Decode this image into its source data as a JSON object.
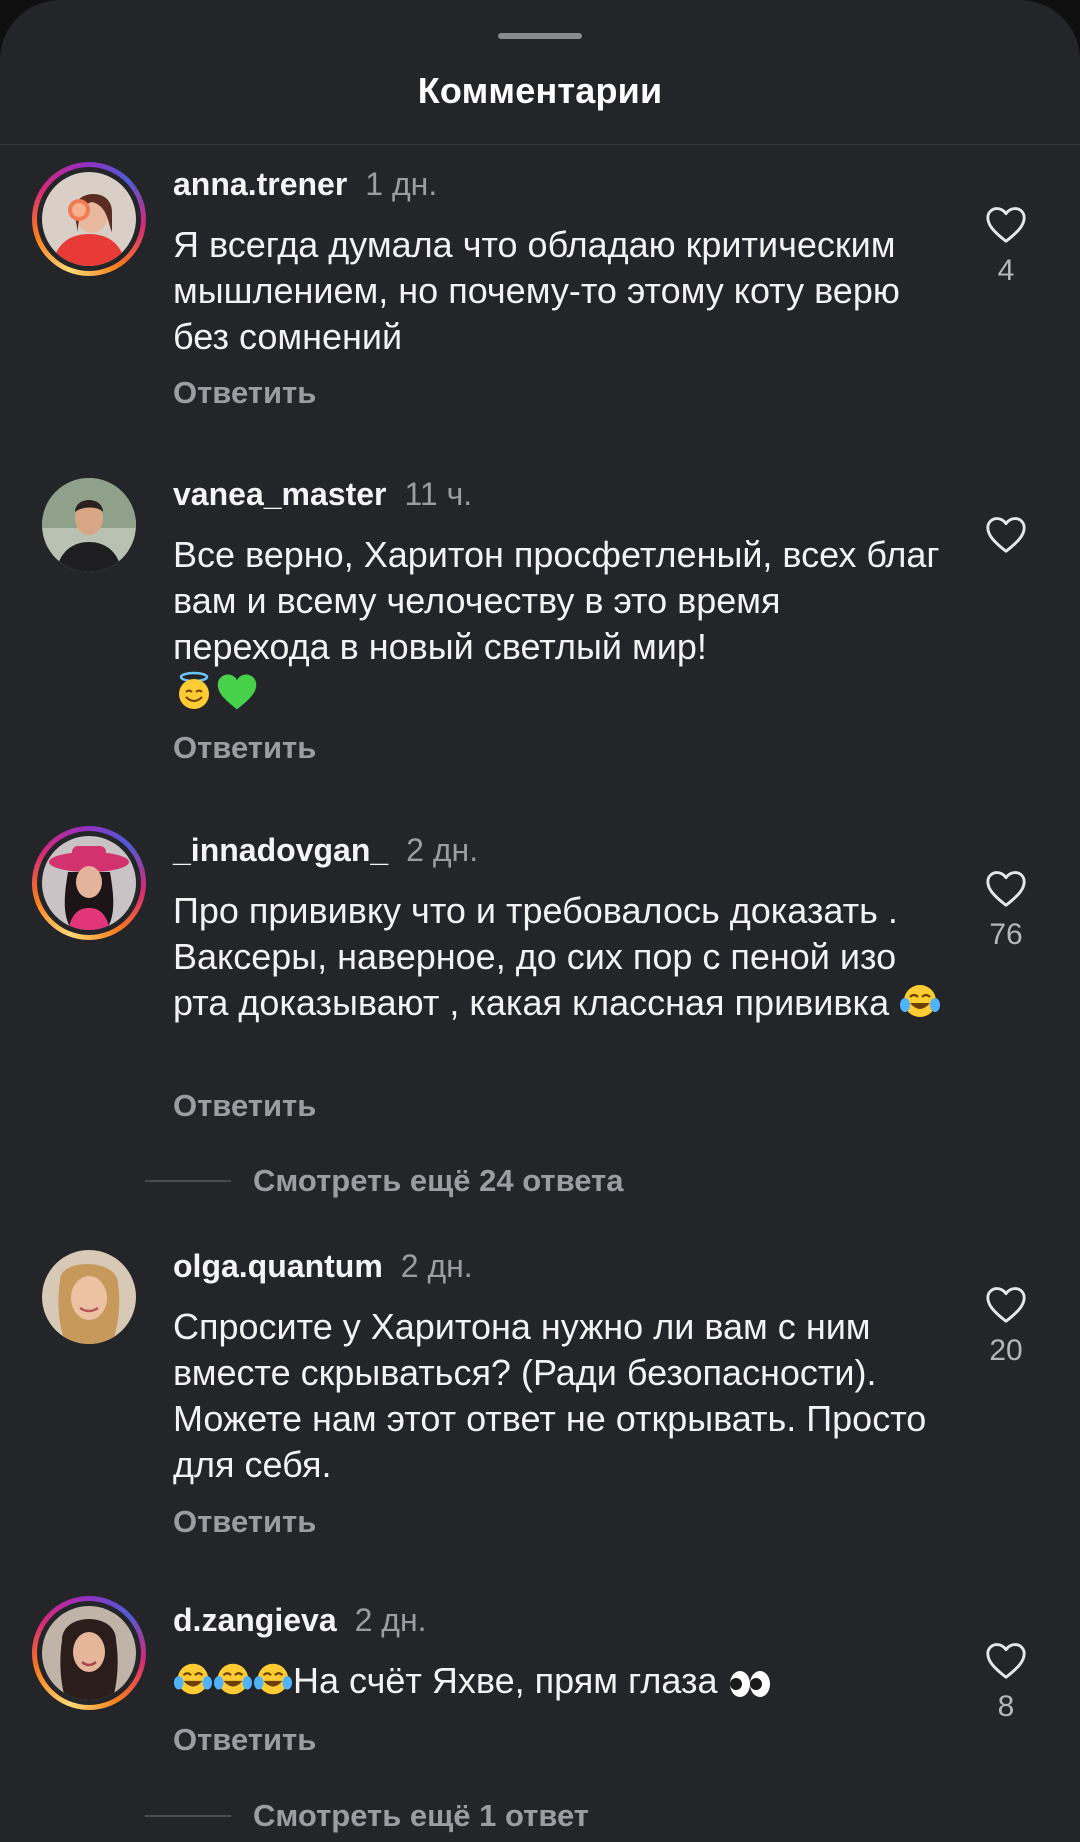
{
  "header": {
    "title": "Комментарии"
  },
  "comments": [
    {
      "username": "anna.trener",
      "time": "1 дн.",
      "text": "Я всегда думала что обладаю критическим мышлением, но почему-то этому коту верю без сомнений",
      "reply_label": "Ответить",
      "likes": "4",
      "story_ring": true
    },
    {
      "username": "vanea_master",
      "time": "11 ч.",
      "text": "Все верно, Харитон просфетленый, всех благ вам и всему челочеству в это время перехода в новый светлый мир!",
      "reply_label": "Ответить",
      "likes": "",
      "story_ring": false
    },
    {
      "username": "_innadovgan_",
      "time": "2 дн.",
      "text": "Про прививку что и требовалось доказать . Ваксеры, наверное, до сих пор с пеной изо рта доказывают , какая классная прививка",
      "reply_label": "Ответить",
      "likes": "76",
      "story_ring": true,
      "view_more": "Смотреть ещё 24 ответа"
    },
    {
      "username": "olga.quantum",
      "time": "2 дн.",
      "text": "Спросите у Харитона нужно ли вам с ним вместе скрываться? (Ради безопасности). Можете нам этот ответ не открывать. Просто для себя.",
      "reply_label": "Ответить",
      "likes": "20",
      "story_ring": false
    },
    {
      "username": "d.zangieva",
      "time": "2 дн.",
      "text": "На счёт Яхве, прям глаза",
      "reply_label": "Ответить",
      "likes": "8",
      "story_ring": true,
      "view_more": "Смотреть ещё 1 ответ"
    }
  ],
  "colors": {
    "background": "#242529",
    "text_primary": "#f2f2f2",
    "text_secondary": "#9c9da2",
    "story_ring": [
      "#feda75",
      "#fa7e1e",
      "#d62976",
      "#962fbf"
    ]
  },
  "icons": {
    "like": "heart-outline-icon",
    "emoji_halo": "smiling-face-with-halo",
    "emoji_green_heart": "green-heart",
    "emoji_tears_of_joy": "face-with-tears-of-joy",
    "emoji_eyes": "eyes"
  }
}
